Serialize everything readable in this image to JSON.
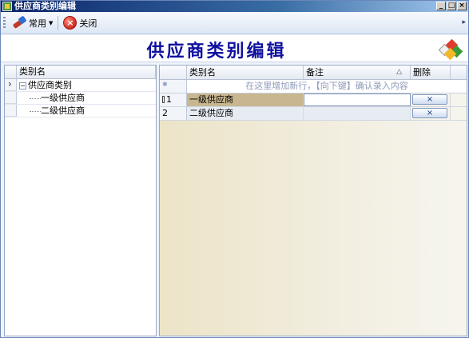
{
  "window": {
    "title": "供应商类别编辑",
    "controls": [
      "_",
      "□",
      "×"
    ]
  },
  "toolbar": {
    "common_label": "常用",
    "close_label": "关闭"
  },
  "banner": {
    "title": "供应商类别编辑"
  },
  "tree": {
    "column_header": "类别名",
    "root": "供应商类别",
    "children": [
      "一级供应商",
      "二级供应商"
    ],
    "toggle": "⊟"
  },
  "grid": {
    "columns": {
      "name": "类别名",
      "note": "备注",
      "delete": "删除"
    },
    "new_row_hint": "在这里增加新行，【向下键】确认录入内容",
    "rows": [
      {
        "index": "1",
        "name": "一级供应商",
        "note": ""
      },
      {
        "index": "2",
        "name": "二级供应商",
        "note": ""
      }
    ],
    "delete_glyph": "×"
  },
  "icons": {
    "common": "common-tools-icon",
    "close": "close-circle-icon",
    "logo": "app-logo-icon"
  },
  "colors": {
    "title_bar": "#0a246a",
    "banner_title": "#1010a0",
    "selected_cell": "#c8b68e"
  }
}
